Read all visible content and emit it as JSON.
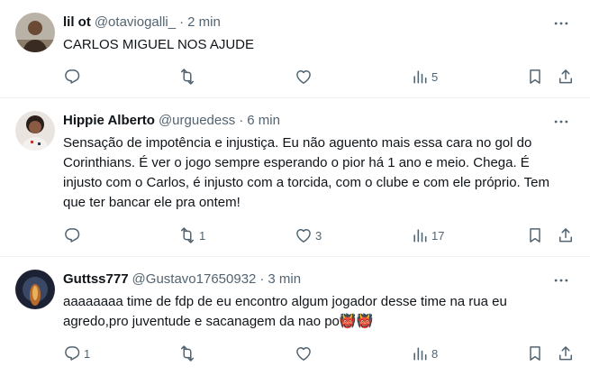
{
  "tweets": [
    {
      "name": "lil ot",
      "handle": "@otaviogalli_",
      "separator": "·",
      "time": "2 min",
      "text": "CARLOS MIGUEL NOS AJUDE",
      "replies": "",
      "retweets": "",
      "likes": "",
      "views": "5"
    },
    {
      "name": "Hippie Alberto",
      "handle": "@urguedess",
      "separator": "·",
      "time": "6 min",
      "text": "Sensação de impotência e injustiça. Eu não aguento mais essa cara no gol do Corinthians. É ver o jogo sempre esperando o pior há 1 ano e meio. Chega. É injusto com o Carlos, é injusto com a torcida, com o clube e com ele próprio. Tem que ter bancar ele pra ontem!",
      "replies": "",
      "retweets": "1",
      "likes": "3",
      "views": "17"
    },
    {
      "name": "Guttss777",
      "handle": "@Gustavo17650932",
      "separator": "·",
      "time": "3 min",
      "text": "aaaaaaaa time de fdp de eu encontro algum jogador desse time na rua eu agredo,pro juventude e sacanagem da nao po",
      "emoji": "👹👹",
      "replies": "1",
      "retweets": "",
      "likes": "",
      "views": "8"
    }
  ],
  "icons": {
    "reply": "reply-icon",
    "retweet": "retweet-icon",
    "like": "like-icon",
    "views": "views-icon",
    "bookmark": "bookmark-icon",
    "share": "share-icon",
    "more": "more-icon"
  }
}
